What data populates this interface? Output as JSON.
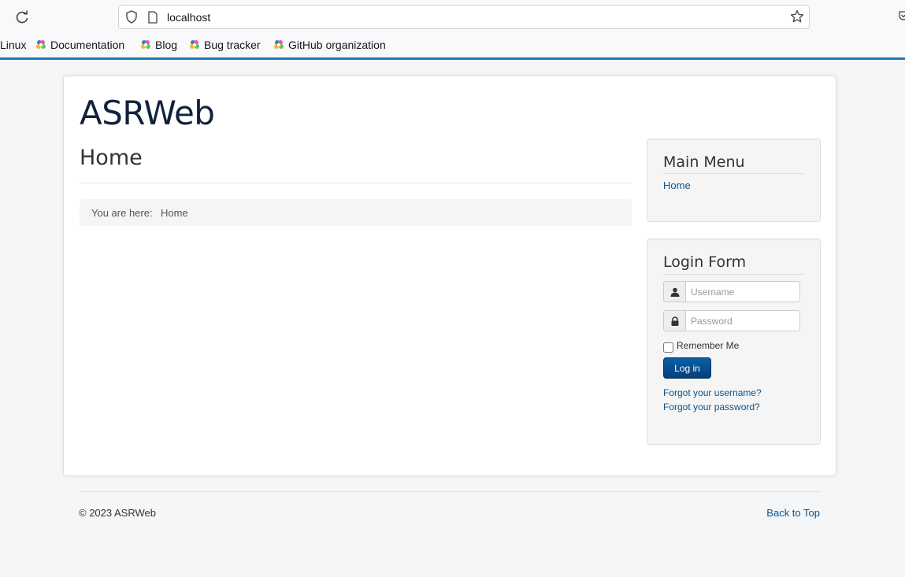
{
  "browser": {
    "url": "localhost",
    "bookmarks": [
      {
        "label": "Linux"
      },
      {
        "label": "Documentation"
      },
      {
        "label": "Blog"
      },
      {
        "label": "Bug tracker"
      },
      {
        "label": "GitHub organization"
      }
    ]
  },
  "site": {
    "brand": "ASRWeb",
    "page_title": "Home",
    "breadcrumb": {
      "label": "You are here:",
      "item": "Home"
    }
  },
  "main_menu": {
    "title": "Main Menu",
    "items": [
      {
        "label": "Home"
      }
    ]
  },
  "login_form": {
    "title": "Login Form",
    "username_placeholder": "Username",
    "password_placeholder": "Password",
    "remember_label": "Remember Me",
    "remember_checked": false,
    "login_button": "Log in",
    "forgot_username": "Forgot your username?",
    "forgot_password": "Forgot your password?"
  },
  "footer": {
    "copyright": "© 2023 ASRWeb",
    "back_to_top": "Back to Top"
  },
  "colors": {
    "accent_line": "#1f7ab5",
    "link": "#08538c",
    "button": "#063f79"
  }
}
